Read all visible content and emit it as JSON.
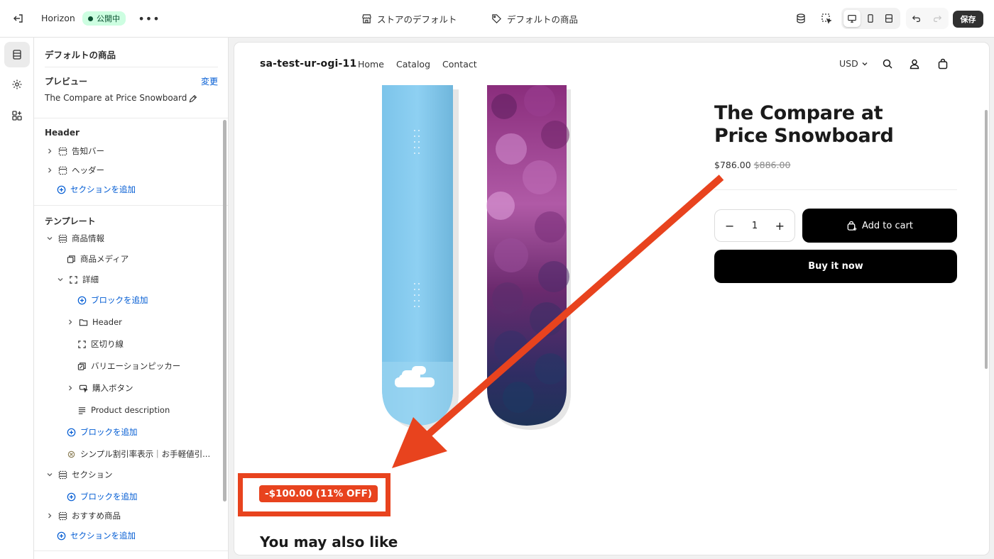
{
  "topbar": {
    "theme_name": "Horizon",
    "status_badge": "公開中",
    "store_default": "ストアのデフォルト",
    "product_default": "デフォルトの商品",
    "save_label": "保存"
  },
  "sidebar": {
    "title": "デフォルトの商品",
    "preview_heading": "プレビュー",
    "change_link": "変更",
    "preview_value": "The Compare at Price Snowboard",
    "header_heading": "Header",
    "header_items": [
      "告知バー",
      "ヘッダー"
    ],
    "add_section": "セクションを追加",
    "template_heading": "テンプレート",
    "tree": {
      "product_info": "商品情報",
      "product_media": "商品メディア",
      "details": "詳細",
      "add_block": "ブロックを追加",
      "header": "Header",
      "divider": "区切り線",
      "variant_picker": "バリエーションピッカー",
      "buy_buttons": "購入ボタン",
      "product_description": "Product description",
      "add_block_2": "ブロックを追加",
      "simple_discount": "シンプル割引率表示｜お手軽値引...",
      "section": "セクション",
      "add_block_3": "ブロックを追加",
      "recommended": "おすすめ商品",
      "add_section_2": "セクションを追加"
    }
  },
  "store": {
    "name": "sa-test-ur-ogi-11",
    "nav": [
      "Home",
      "Catalog",
      "Contact"
    ],
    "currency": "USD",
    "product_title": "The Compare at Price Snowboard",
    "price": "$786.00",
    "compare_price": "$886.00",
    "quantity": "1",
    "add_to_cart": "Add to cart",
    "buy_now": "Buy it now",
    "discount_badge": "-$100.00 (11% OFF)",
    "also_like": "You may also like"
  },
  "colors": {
    "accent": "#005bd3",
    "highlight": "#e8431e",
    "badge_bg": "#cdfee1"
  }
}
